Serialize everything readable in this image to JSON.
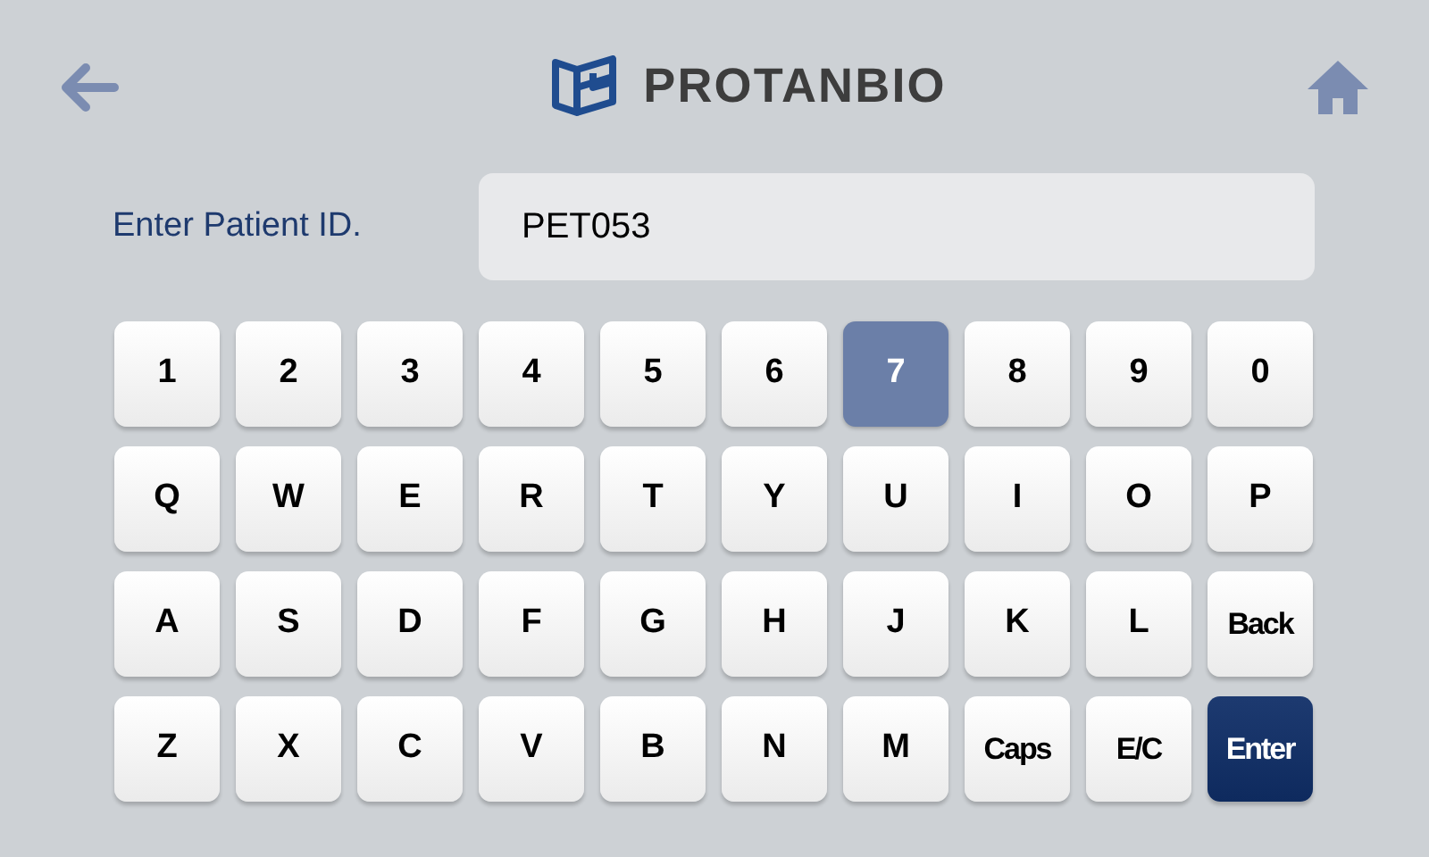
{
  "header": {
    "brand": "PROTANBIO"
  },
  "patient_field": {
    "label": "Enter Patient ID.",
    "value": "PET053"
  },
  "keyboard": {
    "rows": [
      [
        {
          "label": "1",
          "kind": "char",
          "selected": false
        },
        {
          "label": "2",
          "kind": "char",
          "selected": false
        },
        {
          "label": "3",
          "kind": "char",
          "selected": false
        },
        {
          "label": "4",
          "kind": "char",
          "selected": false
        },
        {
          "label": "5",
          "kind": "char",
          "selected": false
        },
        {
          "label": "6",
          "kind": "char",
          "selected": false
        },
        {
          "label": "7",
          "kind": "char",
          "selected": true
        },
        {
          "label": "8",
          "kind": "char",
          "selected": false
        },
        {
          "label": "9",
          "kind": "char",
          "selected": false
        },
        {
          "label": "0",
          "kind": "char",
          "selected": false
        }
      ],
      [
        {
          "label": "Q",
          "kind": "char",
          "selected": false
        },
        {
          "label": "W",
          "kind": "char",
          "selected": false
        },
        {
          "label": "E",
          "kind": "char",
          "selected": false
        },
        {
          "label": "R",
          "kind": "char",
          "selected": false
        },
        {
          "label": "T",
          "kind": "char",
          "selected": false
        },
        {
          "label": "Y",
          "kind": "char",
          "selected": false
        },
        {
          "label": "U",
          "kind": "char",
          "selected": false
        },
        {
          "label": "I",
          "kind": "char",
          "selected": false
        },
        {
          "label": "O",
          "kind": "char",
          "selected": false
        },
        {
          "label": "P",
          "kind": "char",
          "selected": false
        }
      ],
      [
        {
          "label": "A",
          "kind": "char",
          "selected": false
        },
        {
          "label": "S",
          "kind": "char",
          "selected": false
        },
        {
          "label": "D",
          "kind": "char",
          "selected": false
        },
        {
          "label": "F",
          "kind": "char",
          "selected": false
        },
        {
          "label": "G",
          "kind": "char",
          "selected": false
        },
        {
          "label": "H",
          "kind": "char",
          "selected": false
        },
        {
          "label": "J",
          "kind": "char",
          "selected": false
        },
        {
          "label": "K",
          "kind": "char",
          "selected": false
        },
        {
          "label": "L",
          "kind": "char",
          "selected": false
        },
        {
          "label": "Back",
          "kind": "function",
          "selected": false
        }
      ],
      [
        {
          "label": "Z",
          "kind": "char",
          "selected": false
        },
        {
          "label": "X",
          "kind": "char",
          "selected": false
        },
        {
          "label": "C",
          "kind": "char",
          "selected": false
        },
        {
          "label": "V",
          "kind": "char",
          "selected": false
        },
        {
          "label": "B",
          "kind": "char",
          "selected": false
        },
        {
          "label": "N",
          "kind": "char",
          "selected": false
        },
        {
          "label": "M",
          "kind": "char",
          "selected": false
        },
        {
          "label": "Caps",
          "kind": "function",
          "selected": false
        },
        {
          "label": "E/C",
          "kind": "function",
          "selected": false
        },
        {
          "label": "Enter",
          "kind": "primary",
          "selected": false
        }
      ]
    ]
  }
}
